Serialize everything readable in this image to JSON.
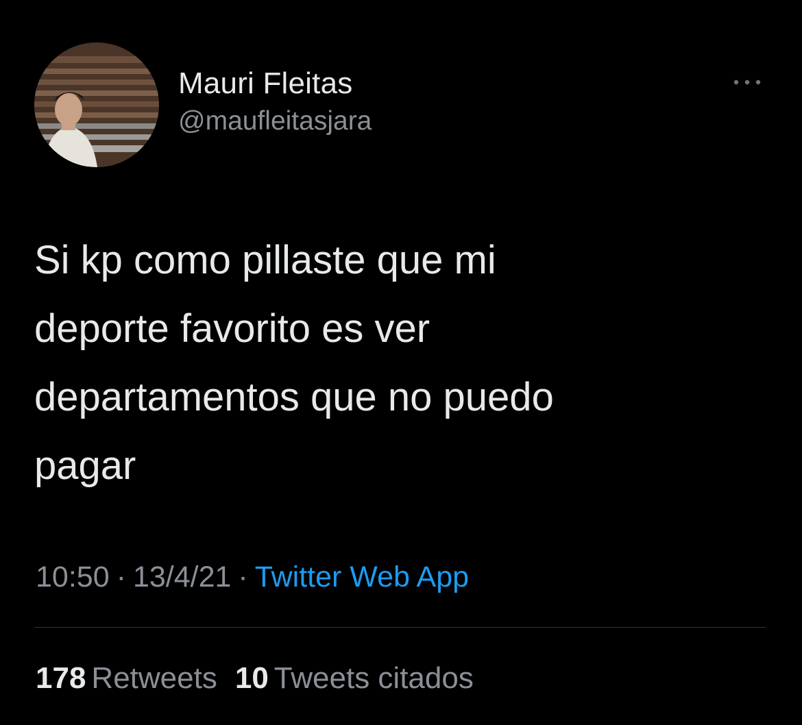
{
  "colors": {
    "background": "#000000",
    "primary_text": "#e7e9ea",
    "secondary_text": "#8b9097",
    "link": "#1d9bf0",
    "divider": "#2f3336"
  },
  "author": {
    "display_name": "Mauri Fleitas",
    "handle": "@maufleitasjara",
    "avatar_icon": "profile-photo"
  },
  "more_icon": "more-horizontal-icon",
  "tweet": {
    "text": "Si kp como pillaste que mi\ndeporte favorito es ver\ndepartamentos que no puedo\npagar"
  },
  "meta": {
    "time": "10:50",
    "date": "13/4/21",
    "separator": "·",
    "source": "Twitter Web App"
  },
  "stats": {
    "retweets_count": "178",
    "retweets_label": "Retweets",
    "quotes_count": "10",
    "quotes_label": "Tweets citados"
  }
}
